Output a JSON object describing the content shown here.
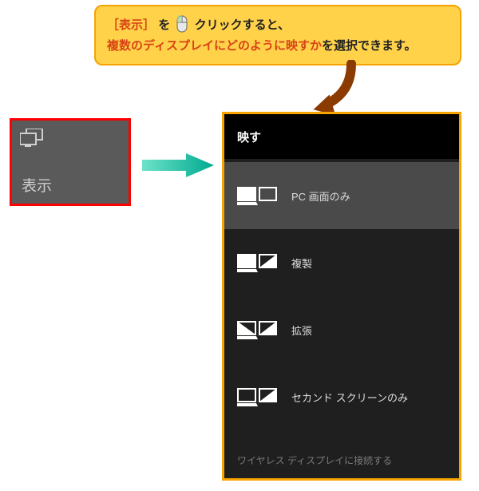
{
  "callout": {
    "bracket_open": "［",
    "label": "表示",
    "bracket_close": "］",
    "text_after_bracket": "を",
    "click_word": "クリック",
    "text_after_click": "すると、",
    "line2_highlight": "複数のディスプレイにどのように映すか",
    "line2_rest": "を選択できます。"
  },
  "left_tile": {
    "label": "表示"
  },
  "panel": {
    "title": "映す",
    "options": [
      {
        "label": "PC 画面のみ",
        "icon": "pc-only",
        "selected": true
      },
      {
        "label": "複製",
        "icon": "duplicate",
        "selected": false
      },
      {
        "label": "拡張",
        "icon": "extend",
        "selected": false
      },
      {
        "label": "セカンド スクリーンのみ",
        "icon": "second-only",
        "selected": false
      }
    ],
    "footer": "ワイヤレス ディスプレイに接続する"
  }
}
